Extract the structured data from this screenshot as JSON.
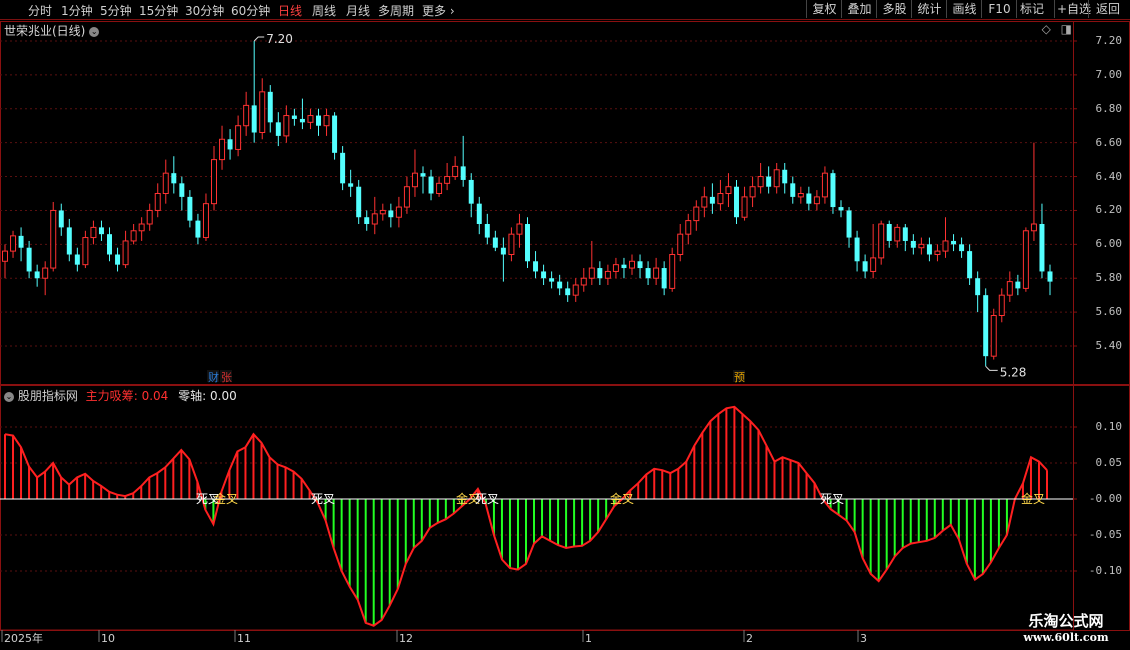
{
  "toolbar": {
    "periods": [
      "分时",
      "1分钟",
      "5分钟",
      "15分钟",
      "30分钟",
      "60分钟",
      "日线",
      "周线",
      "月线",
      "多周期",
      "更多"
    ],
    "active_period": "日线",
    "more_glyph": "›",
    "buttons": [
      "复权",
      "叠加",
      "多股",
      "统计",
      "画线",
      "F10",
      "+自选",
      "返回"
    ],
    "tag_button": "标记"
  },
  "price_panel": {
    "title": "世荣兆业(日线)",
    "max_label": "7.20",
    "min_label": "5.28",
    "markers": [
      {
        "text": "财",
        "color": "#2b7bd6"
      },
      {
        "text": "张",
        "color": "#d23030"
      },
      {
        "text": "预",
        "color": "#e0a000"
      }
    ],
    "axis_ticks": [
      "7.20",
      "7.00",
      "6.80",
      "6.60",
      "6.40",
      "6.20",
      "6.00",
      "5.80",
      "5.60",
      "5.40"
    ]
  },
  "indicator_panel": {
    "name": "股朋指标网",
    "series_label": "主力吸筹",
    "series_value": "0.04",
    "zero_label": "零轴",
    "zero_value": "0.00",
    "axis_ticks": [
      "0.10",
      "0.05",
      "-0.00",
      "-0.05",
      "-0.10"
    ],
    "signals": [
      {
        "text": "死叉",
        "color": "#ffffff"
      },
      {
        "text": "金叉",
        "color": "#ffd84a"
      },
      {
        "text": "死叉",
        "color": "#ffffff"
      },
      {
        "text": "金叉",
        "color": "#ffd84a"
      },
      {
        "text": "死叉",
        "color": "#ffffff"
      },
      {
        "text": "金叉",
        "color": "#ffd84a"
      },
      {
        "text": "死叉",
        "color": "#ffffff"
      },
      {
        "text": "金叉",
        "color": "#ffd84a"
      }
    ]
  },
  "time_axis": {
    "labels": [
      "2025年",
      "10",
      "11",
      "12",
      "1",
      "2",
      "3"
    ]
  },
  "watermark": {
    "line1": "乐淘公式网",
    "line2": "www.60lt.com"
  },
  "colors": {
    "up": "#ff3232",
    "down": "#54ffff",
    "bar_pos": "#ff2020",
    "bar_neg": "#22ff22",
    "frame": "#8a1010",
    "grid": "#5a1010"
  },
  "chart_data": [
    {
      "type": "candlestick",
      "title": "世荣兆业(日线)",
      "ylim": [
        5.2,
        7.25
      ],
      "annotations": [
        {
          "label": "7.20",
          "value": 7.2
        },
        {
          "label": "5.28",
          "value": 5.28
        }
      ],
      "series": [
        {
          "values": [
            [
              5.9,
              5.96,
              5.8,
              6.0
            ],
            [
              5.96,
              6.05,
              5.92,
              6.08
            ],
            [
              6.05,
              5.98,
              5.9,
              6.1
            ],
            [
              5.98,
              5.84,
              5.8,
              6.02
            ],
            [
              5.84,
              5.8,
              5.75,
              5.88
            ],
            [
              5.8,
              5.86,
              5.7,
              5.9
            ],
            [
              5.86,
              6.2,
              5.84,
              6.25
            ],
            [
              6.2,
              6.1,
              6.05,
              6.24
            ],
            [
              6.1,
              5.94,
              5.9,
              6.15
            ],
            [
              5.94,
              5.88,
              5.84,
              5.98
            ],
            [
              5.88,
              6.04,
              5.86,
              6.08
            ],
            [
              6.04,
              6.1,
              6.0,
              6.14
            ],
            [
              6.1,
              6.06,
              6.02,
              6.14
            ],
            [
              6.06,
              5.94,
              5.9,
              6.1
            ],
            [
              5.94,
              5.88,
              5.84,
              5.98
            ],
            [
              5.88,
              6.02,
              5.86,
              6.08
            ],
            [
              6.02,
              6.08,
              6.0,
              6.12
            ],
            [
              6.08,
              6.12,
              6.02,
              6.16
            ],
            [
              6.12,
              6.2,
              6.08,
              6.24
            ],
            [
              6.2,
              6.3,
              6.16,
              6.36
            ],
            [
              6.3,
              6.42,
              6.24,
              6.5
            ],
            [
              6.42,
              6.36,
              6.3,
              6.52
            ],
            [
              6.36,
              6.28,
              6.2,
              6.4
            ],
            [
              6.28,
              6.14,
              6.1,
              6.32
            ],
            [
              6.14,
              6.04,
              6.0,
              6.18
            ],
            [
              6.04,
              6.24,
              6.02,
              6.3
            ],
            [
              6.24,
              6.5,
              6.2,
              6.58
            ],
            [
              6.5,
              6.62,
              6.44,
              6.7
            ],
            [
              6.62,
              6.56,
              6.5,
              6.68
            ],
            [
              6.56,
              6.7,
              6.52,
              6.76
            ],
            [
              6.7,
              6.82,
              6.64,
              6.9
            ],
            [
              6.82,
              6.66,
              6.6,
              7.2
            ],
            [
              6.66,
              6.9,
              6.62,
              6.98
            ],
            [
              6.9,
              6.72,
              6.66,
              6.94
            ],
            [
              6.72,
              6.64,
              6.58,
              6.78
            ],
            [
              6.64,
              6.76,
              6.6,
              6.82
            ],
            [
              6.76,
              6.74,
              6.7,
              6.8
            ],
            [
              6.74,
              6.72,
              6.68,
              6.86
            ],
            [
              6.72,
              6.76,
              6.68,
              6.8
            ],
            [
              6.76,
              6.7,
              6.64,
              6.8
            ],
            [
              6.7,
              6.76,
              6.64,
              6.8
            ],
            [
              6.76,
              6.54,
              6.5,
              6.78
            ],
            [
              6.54,
              6.36,
              6.32,
              6.58
            ],
            [
              6.36,
              6.34,
              6.28,
              6.44
            ],
            [
              6.34,
              6.16,
              6.12,
              6.38
            ],
            [
              6.16,
              6.12,
              6.08,
              6.2
            ],
            [
              6.12,
              6.18,
              6.06,
              6.28
            ],
            [
              6.18,
              6.2,
              6.14,
              6.24
            ],
            [
              6.2,
              6.16,
              6.1,
              6.24
            ],
            [
              6.16,
              6.22,
              6.1,
              6.28
            ],
            [
              6.22,
              6.34,
              6.18,
              6.4
            ],
            [
              6.34,
              6.42,
              6.28,
              6.56
            ],
            [
              6.42,
              6.4,
              6.3,
              6.46
            ],
            [
              6.4,
              6.3,
              6.26,
              6.44
            ],
            [
              6.3,
              6.36,
              6.28,
              6.4
            ],
            [
              6.36,
              6.4,
              6.32,
              6.48
            ],
            [
              6.4,
              6.46,
              6.38,
              6.52
            ],
            [
              6.46,
              6.38,
              6.34,
              6.64
            ],
            [
              6.38,
              6.24,
              6.16,
              6.42
            ],
            [
              6.24,
              6.12,
              6.06,
              6.28
            ],
            [
              6.12,
              6.04,
              6.0,
              6.18
            ],
            [
              6.04,
              5.98,
              5.96,
              6.08
            ],
            [
              5.98,
              5.94,
              5.78,
              6.04
            ],
            [
              5.94,
              6.06,
              5.9,
              6.1
            ],
            [
              6.06,
              6.12,
              5.98,
              6.18
            ],
            [
              6.12,
              5.9,
              5.86,
              6.16
            ],
            [
              5.9,
              5.84,
              5.8,
              5.96
            ],
            [
              5.84,
              5.8,
              5.76,
              5.88
            ],
            [
              5.8,
              5.78,
              5.74,
              5.84
            ],
            [
              5.78,
              5.74,
              5.7,
              5.82
            ],
            [
              5.74,
              5.7,
              5.66,
              5.78
            ],
            [
              5.7,
              5.76,
              5.66,
              5.8
            ],
            [
              5.76,
              5.8,
              5.72,
              5.86
            ],
            [
              5.8,
              5.86,
              5.76,
              6.02
            ],
            [
              5.86,
              5.8,
              5.76,
              5.9
            ],
            [
              5.8,
              5.84,
              5.76,
              5.88
            ],
            [
              5.84,
              5.88,
              5.8,
              5.92
            ],
            [
              5.88,
              5.86,
              5.8,
              5.92
            ],
            [
              5.86,
              5.9,
              5.82,
              5.94
            ],
            [
              5.9,
              5.86,
              5.8,
              5.94
            ],
            [
              5.86,
              5.8,
              5.76,
              5.9
            ],
            [
              5.8,
              5.86,
              5.76,
              5.92
            ],
            [
              5.86,
              5.74,
              5.7,
              5.9
            ],
            [
              5.74,
              5.94,
              5.72,
              5.98
            ],
            [
              5.94,
              6.06,
              5.9,
              6.12
            ],
            [
              6.06,
              6.14,
              6.0,
              6.18
            ],
            [
              6.14,
              6.22,
              6.08,
              6.26
            ],
            [
              6.22,
              6.28,
              6.16,
              6.34
            ],
            [
              6.28,
              6.24,
              6.18,
              6.36
            ],
            [
              6.24,
              6.3,
              6.2,
              6.38
            ],
            [
              6.3,
              6.34,
              6.22,
              6.42
            ],
            [
              6.34,
              6.16,
              6.12,
              6.38
            ],
            [
              6.16,
              6.28,
              6.14,
              6.34
            ],
            [
              6.28,
              6.34,
              6.22,
              6.4
            ],
            [
              6.34,
              6.4,
              6.3,
              6.48
            ],
            [
              6.4,
              6.34,
              6.3,
              6.46
            ],
            [
              6.34,
              6.44,
              6.3,
              6.48
            ],
            [
              6.44,
              6.36,
              6.3,
              6.48
            ],
            [
              6.36,
              6.28,
              6.24,
              6.4
            ],
            [
              6.28,
              6.3,
              6.24,
              6.34
            ],
            [
              6.3,
              6.24,
              6.2,
              6.34
            ],
            [
              6.24,
              6.28,
              6.2,
              6.32
            ],
            [
              6.28,
              6.42,
              6.24,
              6.46
            ],
            [
              6.42,
              6.22,
              6.18,
              6.44
            ],
            [
              6.22,
              6.2,
              6.16,
              6.26
            ],
            [
              6.2,
              6.04,
              5.98,
              6.22
            ],
            [
              6.04,
              5.9,
              5.84,
              6.08
            ],
            [
              5.9,
              5.84,
              5.8,
              5.94
            ],
            [
              5.84,
              5.92,
              5.8,
              6.12
            ],
            [
              5.92,
              6.12,
              5.88,
              6.14
            ],
            [
              6.12,
              6.02,
              5.98,
              6.14
            ],
            [
              6.02,
              6.1,
              5.98,
              6.12
            ],
            [
              6.1,
              6.02,
              5.96,
              6.12
            ],
            [
              6.02,
              5.98,
              5.94,
              6.06
            ],
            [
              5.98,
              6.0,
              5.94,
              6.04
            ],
            [
              6.0,
              5.94,
              5.9,
              6.04
            ],
            [
              5.94,
              5.96,
              5.9,
              6.0
            ],
            [
              5.96,
              6.02,
              5.92,
              6.16
            ],
            [
              6.02,
              6.0,
              5.96,
              6.06
            ],
            [
              6.0,
              5.96,
              5.92,
              6.04
            ],
            [
              5.96,
              5.8,
              5.76,
              6.0
            ],
            [
              5.8,
              5.7,
              5.6,
              5.84
            ],
            [
              5.7,
              5.34,
              5.28,
              5.74
            ],
            [
              5.34,
              5.58,
              5.32,
              5.62
            ],
            [
              5.58,
              5.7,
              5.54,
              5.74
            ],
            [
              5.7,
              5.78,
              5.66,
              5.84
            ],
            [
              5.78,
              5.74,
              5.7,
              5.82
            ],
            [
              5.74,
              6.08,
              5.72,
              6.1
            ],
            [
              6.08,
              6.12,
              6.02,
              6.6
            ],
            [
              6.12,
              5.84,
              5.8,
              6.24
            ],
            [
              5.84,
              5.78,
              5.7,
              5.88
            ]
          ]
        }
      ]
    },
    {
      "type": "bar",
      "title": "主力吸筹",
      "ylim": [
        -0.145,
        0.14
      ],
      "series": [
        {
          "name": "主力吸筹",
          "values": [
            0.09,
            0.088,
            0.072,
            0.045,
            0.03,
            0.038,
            0.05,
            0.03,
            0.02,
            0.03,
            0.035,
            0.025,
            0.018,
            0.01,
            0.006,
            0.004,
            0.008,
            0.018,
            0.03,
            0.036,
            0.044,
            0.056,
            0.068,
            0.055,
            0.024,
            -0.015,
            -0.035,
            0.01,
            0.04,
            0.066,
            0.072,
            0.09,
            0.078,
            0.058,
            0.048,
            0.044,
            0.038,
            0.028,
            0.012,
            -0.005,
            -0.03,
            -0.068,
            -0.1,
            -0.122,
            -0.14,
            -0.172,
            -0.176,
            -0.168,
            -0.148,
            -0.125,
            -0.09,
            -0.068,
            -0.058,
            -0.04,
            -0.033,
            -0.028,
            -0.02,
            -0.01,
            0.0,
            0.014,
            -0.008,
            -0.05,
            -0.084,
            -0.096,
            -0.098,
            -0.09,
            -0.062,
            -0.052,
            -0.058,
            -0.064,
            -0.068,
            -0.066,
            -0.065,
            -0.058,
            -0.046,
            -0.028,
            -0.01,
            0.0,
            0.012,
            0.022,
            0.034,
            0.042,
            0.04,
            0.036,
            0.042,
            0.052,
            0.074,
            0.092,
            0.108,
            0.118,
            0.126,
            0.128,
            0.118,
            0.108,
            0.096,
            0.074,
            0.052,
            0.058,
            0.054,
            0.05,
            0.036,
            0.022,
            0.0,
            -0.014,
            -0.022,
            -0.03,
            -0.046,
            -0.082,
            -0.104,
            -0.114,
            -0.098,
            -0.08,
            -0.068,
            -0.062,
            -0.06,
            -0.058,
            -0.054,
            -0.044,
            -0.036,
            -0.056,
            -0.09,
            -0.112,
            -0.104,
            -0.088,
            -0.068,
            -0.05,
            0.0,
            0.022,
            0.058,
            0.052,
            0.04
          ]
        }
      ]
    }
  ]
}
